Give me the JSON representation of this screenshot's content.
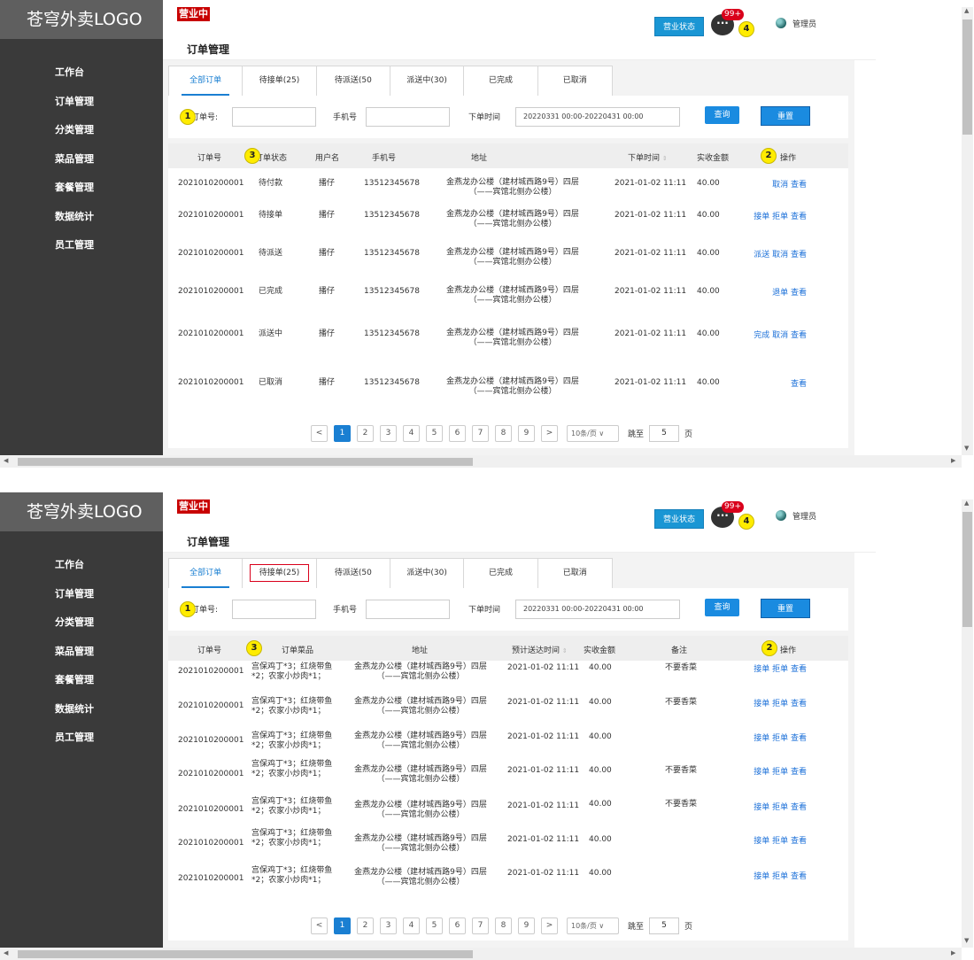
{
  "app": {
    "logo": "苍穹外卖LOGO",
    "open_badge": "营业中",
    "page_title": "订单管理",
    "status_button": "营业状态",
    "chat_icon_text": "···",
    "message_count": "99+",
    "admin_name": "管理员",
    "menu": [
      "工作台",
      "订单管理",
      "分类管理",
      "菜品管理",
      "套餐管理",
      "数据统计",
      "员工管理"
    ]
  },
  "markers": {
    "m1": "1",
    "m2": "2",
    "m3": "3",
    "m4": "4"
  },
  "filter": {
    "order_no_label": "订单号:",
    "phone_label": "手机号",
    "time_label": "下单时间",
    "time_value": "20220331 00:00-20220431 00:00",
    "query_button": "查询",
    "reset_button": "重置"
  },
  "pagination": {
    "pages": [
      "1",
      "2",
      "3",
      "4",
      "5",
      "6",
      "7",
      "8",
      "9"
    ],
    "prev": "<",
    "next": ">",
    "page_size": "10条/页 ∨",
    "jump_label": "跳至",
    "jump_value": "5",
    "page_unit": "页"
  },
  "view1": {
    "tabs": [
      "全部订单",
      "待接单(25)",
      "待派送(50",
      "派送中(30)",
      "已完成",
      "已取消"
    ],
    "headers": {
      "order_no": "订单号",
      "status": "订单状态",
      "user": "用户名",
      "phone": "手机号",
      "address": "地址",
      "time": "下单时间",
      "sort_icon": "⇕",
      "amount": "实收金额",
      "ops": "操作"
    },
    "rows": [
      {
        "order_no": "2021010200001",
        "status": "待付款",
        "user": "播仔",
        "phone": "13512345678",
        "address": "金燕龙办公楼（建材城西路9号）四层（——宾馆北侧办公楼）",
        "time": "2021-01-02 11:11",
        "amount": "40.00",
        "ops": "取消  查看"
      },
      {
        "order_no": "2021010200001",
        "status": "待接单",
        "user": "播仔",
        "phone": "13512345678",
        "address": "金燕龙办公楼（建材城西路9号）四层（——宾馆北侧办公楼）",
        "time": "2021-01-02 11:11",
        "amount": "40.00",
        "ops": "接单  拒单  查看"
      },
      {
        "order_no": "2021010200001",
        "status": "待派送",
        "user": "播仔",
        "phone": "13512345678",
        "address": "金燕龙办公楼（建材城西路9号）四层（——宾馆北侧办公楼）",
        "time": "2021-01-02 11:11",
        "amount": "40.00",
        "ops": "派送  取消  查看"
      },
      {
        "order_no": "2021010200001",
        "status": "已完成",
        "user": "播仔",
        "phone": "13512345678",
        "address": "金燕龙办公楼（建材城西路9号）四层（——宾馆北侧办公楼）",
        "time": "2021-01-02 11:11",
        "amount": "40.00",
        "ops": "退单  查看"
      },
      {
        "order_no": "2021010200001",
        "status": "派送中",
        "user": "播仔",
        "phone": "13512345678",
        "address": "金燕龙办公楼（建材城西路9号）四层（——宾馆北侧办公楼）",
        "time": "2021-01-02 11:11",
        "amount": "40.00",
        "ops": "完成  取消  查看"
      },
      {
        "order_no": "2021010200001",
        "status": "已取消",
        "user": "播仔",
        "phone": "13512345678",
        "address": "金燕龙办公楼（建材城西路9号）四层（——宾馆北侧办公楼）",
        "time": "2021-01-02 11:11",
        "amount": "40.00",
        "ops": "查看"
      }
    ]
  },
  "view2": {
    "tabs": [
      "全部订单",
      "待接单(25)",
      "待派送(50",
      "派送中(30)",
      "已完成",
      "已取消"
    ],
    "headers": {
      "order_no": "订单号",
      "dishes": "订单菜品",
      "address": "地址",
      "eta": "预计送达时间",
      "sort_icon": "⇕",
      "amount": "实收金额",
      "remark": "备注",
      "ops": "操作"
    },
    "rows": [
      {
        "order_no": "2021010200001",
        "dishes": "宫保鸡丁*3；红烧带鱼*2；农家小炒肉*1；",
        "address": "金燕龙办公楼（建材城西路9号）四层（——宾馆北侧办公楼）",
        "eta": "2021-01-02 11:11",
        "amount": "40.00",
        "remark": "不要香菜",
        "ops": "接单  拒单  查看"
      },
      {
        "order_no": "2021010200001",
        "dishes": "宫保鸡丁*3；红烧带鱼*2；农家小炒肉*1；",
        "address": "金燕龙办公楼（建材城西路9号）四层（——宾馆北侧办公楼）",
        "eta": "2021-01-02 11:11",
        "amount": "40.00",
        "remark": "不要香菜",
        "ops": "接单  拒单  查看"
      },
      {
        "order_no": "2021010200001",
        "dishes": "宫保鸡丁*3；红烧带鱼*2；农家小炒肉*1；",
        "address": "金燕龙办公楼（建材城西路9号）四层（——宾馆北侧办公楼）",
        "eta": "2021-01-02 11:11",
        "amount": "40.00",
        "remark": "",
        "ops": "接单  拒单  查看"
      },
      {
        "order_no": "2021010200001",
        "dishes": "宫保鸡丁*3；红烧带鱼*2；农家小炒肉*1；",
        "address": "金燕龙办公楼（建材城西路9号）四层（——宾馆北侧办公楼）",
        "eta": "2021-01-02 11:11",
        "amount": "40.00",
        "remark": "不要香菜",
        "ops": "接单  拒单  查看"
      },
      {
        "order_no": "2021010200001",
        "dishes": "宫保鸡丁*3；红烧带鱼*2；农家小炒肉*1；",
        "address": "金燕龙办公楼（建材城西路9号）四层（——宾馆北侧办公楼）",
        "eta": "2021-01-02 11:11",
        "amount": "40.00",
        "remark": "不要香菜",
        "ops": "接单  拒单  查看"
      },
      {
        "order_no": "2021010200001",
        "dishes": "宫保鸡丁*3；红烧带鱼*2；农家小炒肉*1；",
        "address": "金燕龙办公楼（建材城西路9号）四层（——宾馆北侧办公楼）",
        "eta": "2021-01-02 11:11",
        "amount": "40.00",
        "remark": "",
        "ops": "接单  拒单  查看"
      },
      {
        "order_no": "2021010200001",
        "dishes": "宫保鸡丁*3；红烧带鱼*2；农家小炒肉*1；",
        "address": "金燕龙办公楼（建材城西路9号）四层（——宾馆北侧办公楼）",
        "eta": "2021-01-02 11:11",
        "amount": "40.00",
        "remark": "",
        "ops": "接单  拒单  查看"
      }
    ]
  },
  "icons": {
    "scroll_up": "▲",
    "scroll_down": "▼",
    "scroll_left": "◀",
    "scroll_right": "▶"
  }
}
